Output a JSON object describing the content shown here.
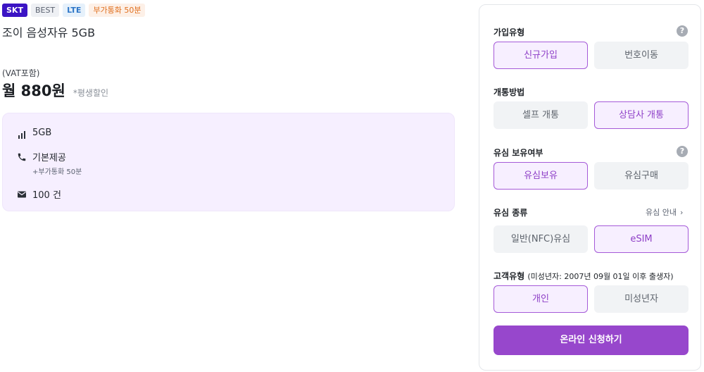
{
  "badges": {
    "carrier": "SKT",
    "tier": "BEST",
    "network": "LTE",
    "bonus": "부가통화 50분"
  },
  "plan": {
    "name": "조이 음성자유 5GB",
    "vat_note": "(VAT포함)",
    "price": "월 880원",
    "discount_note": "*평생할인"
  },
  "benefits": {
    "data": {
      "icon": "signal-bars-icon",
      "label": "5GB"
    },
    "voice": {
      "icon": "phone-icon",
      "label": "기본제공",
      "sub": "+부가통화 50분"
    },
    "sms": {
      "icon": "envelope-icon",
      "label": "100 건"
    }
  },
  "options": {
    "join_type": {
      "label": "가입유형",
      "choices": [
        "신규가입",
        "번호이동"
      ],
      "selected": "신규가입"
    },
    "activation": {
      "label": "개통방법",
      "choices": [
        "셀프 개통",
        "상담사 개통"
      ],
      "selected": "상담사 개통"
    },
    "usim_owned": {
      "label": "유심 보유여부",
      "choices": [
        "유심보유",
        "유심구매"
      ],
      "selected": "유심보유"
    },
    "sim_type": {
      "label": "유심 종류",
      "guide": "유심 안내",
      "choices": [
        "일반(NFC)유심",
        "eSIM"
      ],
      "selected": "eSIM"
    },
    "customer_type": {
      "label": "고객유형",
      "note": "(미성년자: 2007년 09월 01일 이후 출생자)",
      "choices": [
        "개인",
        "미성년자"
      ],
      "selected": "개인"
    }
  },
  "help_glyph": "?",
  "apply_label": "온라인 신청하기",
  "colors": {
    "accent": "#9747cc",
    "carrier_badge": "#3b14c4",
    "benefit_bg": "#f6efff"
  }
}
